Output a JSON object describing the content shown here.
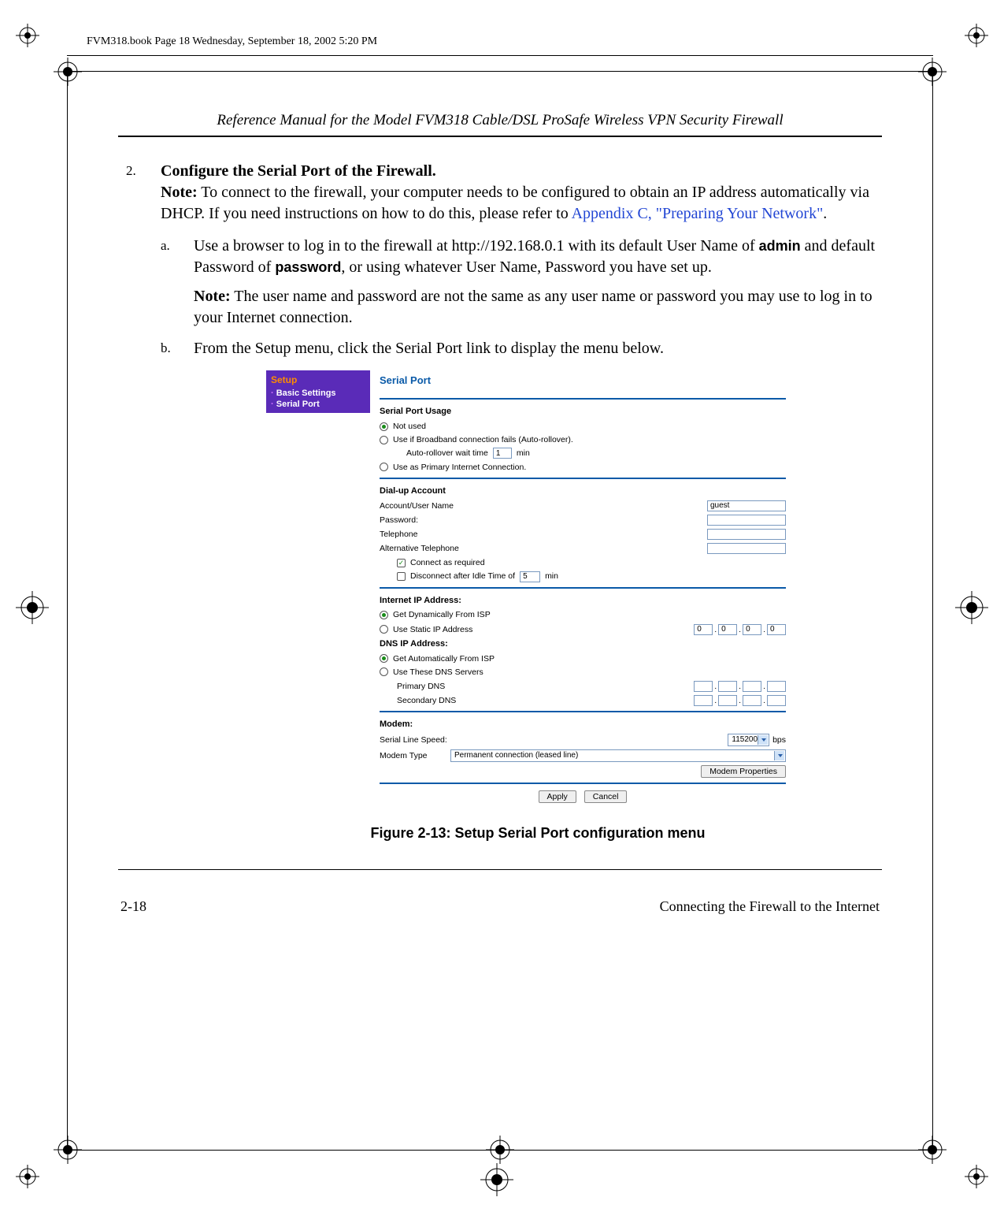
{
  "slug": "FVM318.book  Page 18  Wednesday, September 18, 2002  5:20 PM",
  "running_head": "Reference Manual for the Model FVM318 Cable/DSL ProSafe Wireless VPN Security Firewall",
  "step": {
    "number": "2.",
    "title": "Configure the Serial Port of the Firewall.",
    "note_label": "Note:",
    "note_text": " To connect to the firewall, your computer needs to be configured to obtain an IP address automatically via DHCP. If you need instructions on how to do this, please refer to ",
    "xref": "Appendix C, \"Preparing Your Network\"",
    "period": ".",
    "sub_a": {
      "marker": "a.",
      "text_1": "Use a browser to log in to the firewall at http://192.168.0.1 with its default User Name of ",
      "admin": "admin",
      "text_2": " and default Password of ",
      "password": "password",
      "text_3": ", or using whatever User Name, Password you have set up.",
      "note_label": "Note:",
      "note_text": " The user name and password are not the same as any user name or password you may use to log in to your Internet connection."
    },
    "sub_b": {
      "marker": "b.",
      "text": "From the Setup menu, click the Serial Port link to display the menu below."
    }
  },
  "ui": {
    "sidebar": {
      "header": "Setup",
      "items": [
        "Basic Settings",
        "Serial Port"
      ]
    },
    "title": "Serial Port",
    "usage": {
      "label": "Serial Port Usage",
      "opt_notused": "Not used",
      "opt_rollover": "Use if Broadband connection fails (Auto-rollover).",
      "rollover_wait_pre": "Auto-rollover wait time",
      "rollover_wait_val": "1",
      "rollover_wait_unit": "min",
      "opt_primary": "Use as Primary Internet Connection."
    },
    "dial": {
      "label": "Dial-up Account",
      "acct": "Account/User Name",
      "acct_val": "guest",
      "pwd": "Password:",
      "tel": "Telephone",
      "alt_tel": "Alternative Telephone",
      "connect_req": "Connect as required",
      "disc_pre": "Disconnect after Idle Time of",
      "disc_val": "5",
      "disc_unit": "min"
    },
    "ip": {
      "inet_label": "Internet IP Address:",
      "dyn": "Get Dynamically From ISP",
      "static_lbl": "Use Static IP Address",
      "static_vals": [
        "0",
        "0",
        "0",
        "0"
      ],
      "dns_label": "DNS IP Address:",
      "dns_auto": "Get Automatically From ISP",
      "dns_use": "Use These DNS Servers",
      "pri": "Primary DNS",
      "sec": "Secondary DNS"
    },
    "modem": {
      "label": "Modem:",
      "speed_lbl": "Serial Line Speed:",
      "speed_val": "115200",
      "speed_unit": "bps",
      "type_lbl": "Modem Type",
      "type_val": "Permanent connection (leased line)",
      "props_btn": "Modem Properties"
    },
    "buttons": {
      "apply": "Apply",
      "cancel": "Cancel"
    }
  },
  "figure_caption": "Figure 2-13: Setup Serial Port configuration menu",
  "footer": {
    "page": "2-18",
    "section": "Connecting the Firewall to the Internet"
  }
}
